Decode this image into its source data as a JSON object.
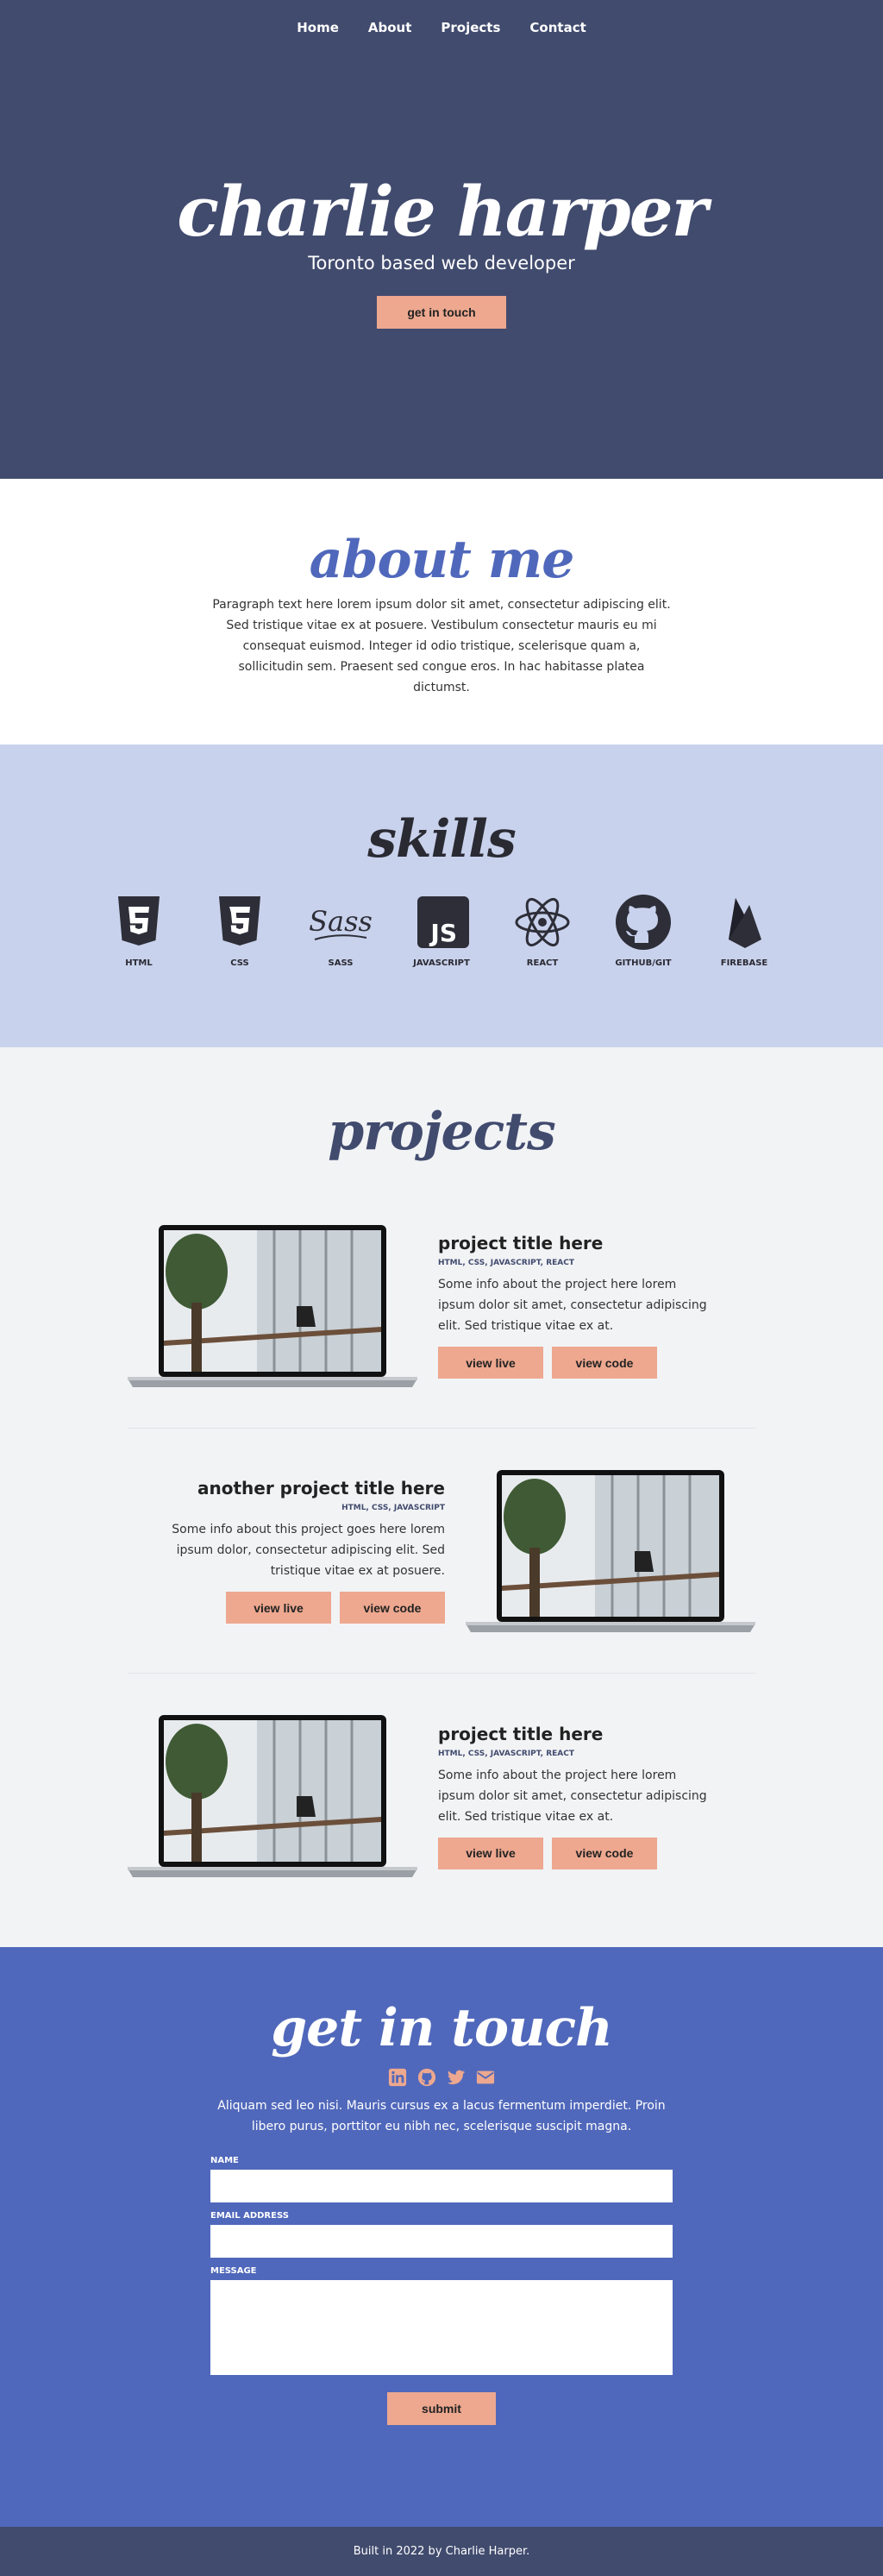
{
  "nav": {
    "items": [
      "Home",
      "About",
      "Projects",
      "Contact"
    ]
  },
  "hero": {
    "title": "charlie harper",
    "subtitle": "Toronto based web developer",
    "cta": "get in touch"
  },
  "about": {
    "title": "about me",
    "text": "Paragraph text here lorem ipsum dolor sit amet, consectetur adipiscing elit. Sed tristique vitae ex at posuere. Vestibulum consectetur mauris eu mi consequat euismod. Integer id odio tristique, scelerisque quam a, sollicitudin sem. Praesent sed congue eros. In hac habitasse platea dictumst."
  },
  "skills": {
    "title": "skills",
    "items": [
      {
        "label": "HTML",
        "icon": "html5-icon"
      },
      {
        "label": "CSS",
        "icon": "css3-icon"
      },
      {
        "label": "SASS",
        "icon": "sass-icon"
      },
      {
        "label": "JAVASCRIPT",
        "icon": "javascript-icon"
      },
      {
        "label": "REACT",
        "icon": "react-icon"
      },
      {
        "label": "GITHUB/GIT",
        "icon": "github-icon"
      },
      {
        "label": "FIREBASE",
        "icon": "firebase-icon"
      }
    ]
  },
  "projects": {
    "title": "projects",
    "items": [
      {
        "title": "project title here",
        "tech": "HTML, CSS, JAVASCRIPT, REACT",
        "desc": "Some info about the project here lorem ipsum dolor sit amet, consectetur adipiscing elit. Sed tristique vitae ex at.",
        "live": "view live",
        "code": "view code"
      },
      {
        "title": "another project title here",
        "tech": "HTML, CSS, JAVASCRIPT",
        "desc": "Some info about this project goes here lorem ipsum dolor, consectetur adipiscing elit. Sed tristique vitae ex at posuere.",
        "live": "view live",
        "code": "view code"
      },
      {
        "title": "project title here",
        "tech": "HTML, CSS, JAVASCRIPT, REACT",
        "desc": "Some info about the project here lorem ipsum dolor sit amet, consectetur adipiscing elit. Sed tristique vitae ex at.",
        "live": "view live",
        "code": "view code"
      }
    ]
  },
  "contact": {
    "title": "get in touch",
    "socials": [
      "linkedin-icon",
      "github-icon",
      "twitter-icon",
      "email-icon"
    ],
    "text": "Aliquam sed leo nisi. Mauris cursus ex a lacus fermentum imperdiet. Proin libero purus, porttitor eu nibh nec, scelerisque suscipit magna.",
    "name_label": "NAME",
    "email_label": "EMAIL ADDRESS",
    "message_label": "MESSAGE",
    "submit": "submit"
  },
  "footer": {
    "text": "Built in 2022 by Charlie Harper."
  },
  "colors": {
    "navy": "#414b6e",
    "blue": "#5068bb",
    "lavender": "#c9d2ec",
    "salmon": "#eda88f",
    "light": "#f2f3f5"
  }
}
